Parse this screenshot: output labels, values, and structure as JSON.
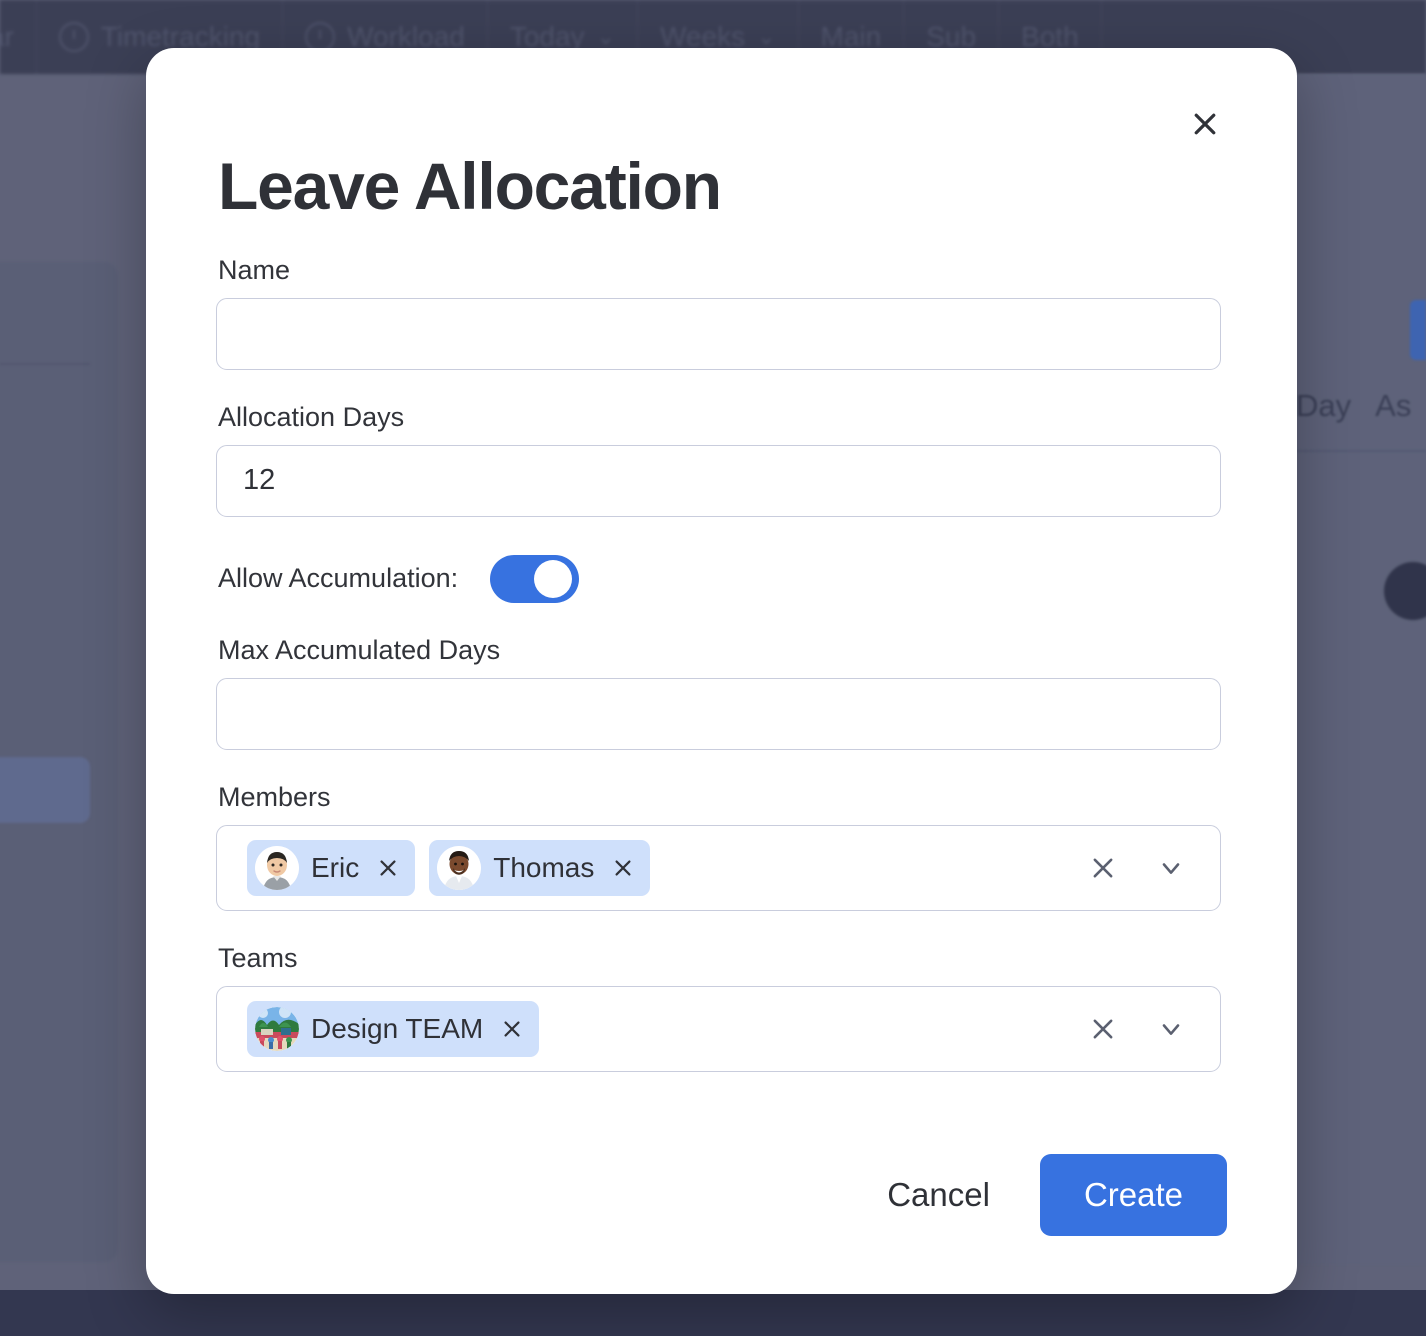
{
  "background": {
    "toolbar_items": [
      {
        "label": "lendar",
        "icon": ""
      },
      {
        "label": "Timetracking",
        "icon": "clock-icon"
      },
      {
        "label": "Workload",
        "icon": "gauge-icon"
      },
      {
        "label": "Today",
        "icon": "chevron-down-icon"
      },
      {
        "label": "Weeks",
        "icon": "chevron-down-icon"
      },
      {
        "label": "Main",
        "icon": ""
      },
      {
        "label": "Sub",
        "icon": ""
      },
      {
        "label": "Both",
        "icon": ""
      }
    ],
    "right_labels": [
      "Day",
      "As"
    ]
  },
  "modal": {
    "title": "Leave Allocation",
    "close_icon": "close-icon",
    "fields": {
      "name": {
        "label": "Name",
        "value": "",
        "placeholder": ""
      },
      "allocation_days": {
        "label": "Allocation Days",
        "value": "12",
        "placeholder": ""
      },
      "allow_accumulation": {
        "label": "Allow Accumulation:",
        "enabled": true
      },
      "max_accumulated_days": {
        "label": "Max Accumulated Days",
        "value": "",
        "placeholder": ""
      },
      "members": {
        "label": "Members",
        "chips": [
          {
            "name": "Eric",
            "avatar": "avatar-eric",
            "remove_icon": "close-icon"
          },
          {
            "name": "Thomas",
            "avatar": "avatar-thomas",
            "remove_icon": "close-icon"
          }
        ],
        "clear_icon": "close-icon",
        "dropdown_icon": "chevron-down-icon"
      },
      "teams": {
        "label": "Teams",
        "chips": [
          {
            "name": "Design TEAM",
            "avatar": "avatar-design-team",
            "remove_icon": "close-icon"
          }
        ],
        "clear_icon": "close-icon",
        "dropdown_icon": "chevron-down-icon"
      }
    },
    "footer": {
      "cancel_label": "Cancel",
      "create_label": "Create"
    }
  },
  "colors": {
    "accent": "#3772e0",
    "chip_bg": "#cfe0fb",
    "border": "#c9cddd",
    "text": "#2f3137",
    "backdrop": "#6c7087",
    "toolbar": "#3b3f55"
  }
}
